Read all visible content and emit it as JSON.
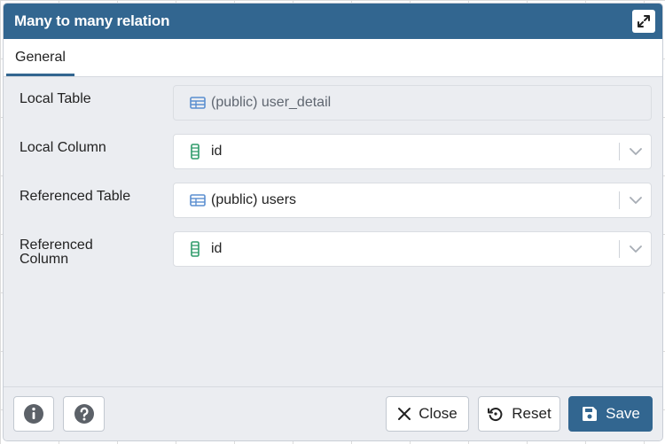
{
  "dialog": {
    "title": "Many to many relation",
    "maximize_icon": "maximize-icon"
  },
  "tabs": [
    {
      "label": "General",
      "active": true
    }
  ],
  "form": {
    "local_table": {
      "label": "Local Table",
      "value": "(public) user_detail",
      "icon": "table-icon",
      "disabled": true
    },
    "local_column": {
      "label": "Local Column",
      "value": "id",
      "icon": "column-icon"
    },
    "referenced_table": {
      "label": "Referenced Table",
      "value": "(public) users",
      "icon": "table-icon"
    },
    "referenced_column": {
      "label_line1": "Referenced",
      "label_line2": "Column",
      "value": "id",
      "icon": "column-icon"
    }
  },
  "footer": {
    "info_icon": "info-icon",
    "help_icon": "help-icon",
    "close_label": "Close",
    "reset_label": "Reset",
    "save_label": "Save"
  },
  "colors": {
    "titlebar": "#326690",
    "primary": "#326690",
    "table_icon": "#5b8fd0",
    "column_icon": "#2f9b6a"
  }
}
